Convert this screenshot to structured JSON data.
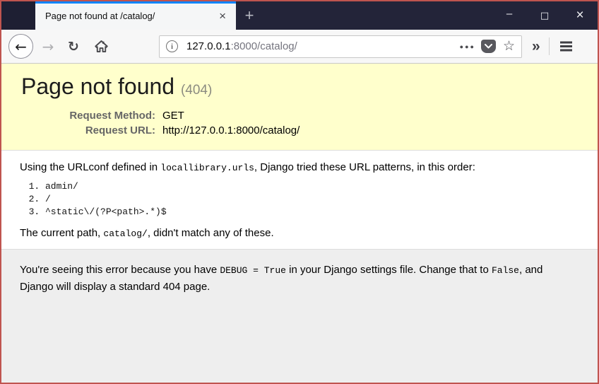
{
  "window": {
    "tab_title": "Page not found at /catalog/",
    "tab_close_glyph": "×",
    "new_tab_glyph": "+",
    "minimize_glyph": "–",
    "maximize_glyph": "□",
    "close_glyph": "×"
  },
  "toolbar": {
    "back_glyph": "←",
    "forward_glyph": "→",
    "reload_glyph": "↻",
    "info_glyph": "i",
    "page_actions_glyph": "●●●",
    "star_glyph": "☆",
    "overflow_glyph": "»",
    "urlbar": {
      "host": "127.0.0.1",
      "path": ":8000/catalog/"
    }
  },
  "page": {
    "summary": {
      "title": "Page not found",
      "status_code": "(404)",
      "rows": [
        {
          "label": "Request Method:",
          "value": "GET"
        },
        {
          "label": "Request URL:",
          "value": "http://127.0.0.1:8000/catalog/"
        }
      ]
    },
    "main": {
      "intro_pre": "Using the URLconf defined in ",
      "intro_code": "locallibrary.urls",
      "intro_post": ", Django tried these URL patterns, in this order:",
      "patterns": [
        "admin/",
        "/",
        "^static\\/(?P<path>.*)$"
      ],
      "current_pre": "The current path, ",
      "current_code": "catalog/",
      "current_post": ", didn't match any of these."
    },
    "explanation": {
      "pre": "You're seeing this error because you have ",
      "code1": "DEBUG = True",
      "mid": " in your Django settings file. Change that to ",
      "code2": "False",
      "post": ", and Django will display a standard 404 page."
    }
  },
  "colors": {
    "accent_blue": "#0a84ff",
    "titlebar_bg": "#232439",
    "summary_bg": "#ffffcc",
    "explanation_bg": "#eeeeee",
    "frame_border": "#bf544f"
  }
}
